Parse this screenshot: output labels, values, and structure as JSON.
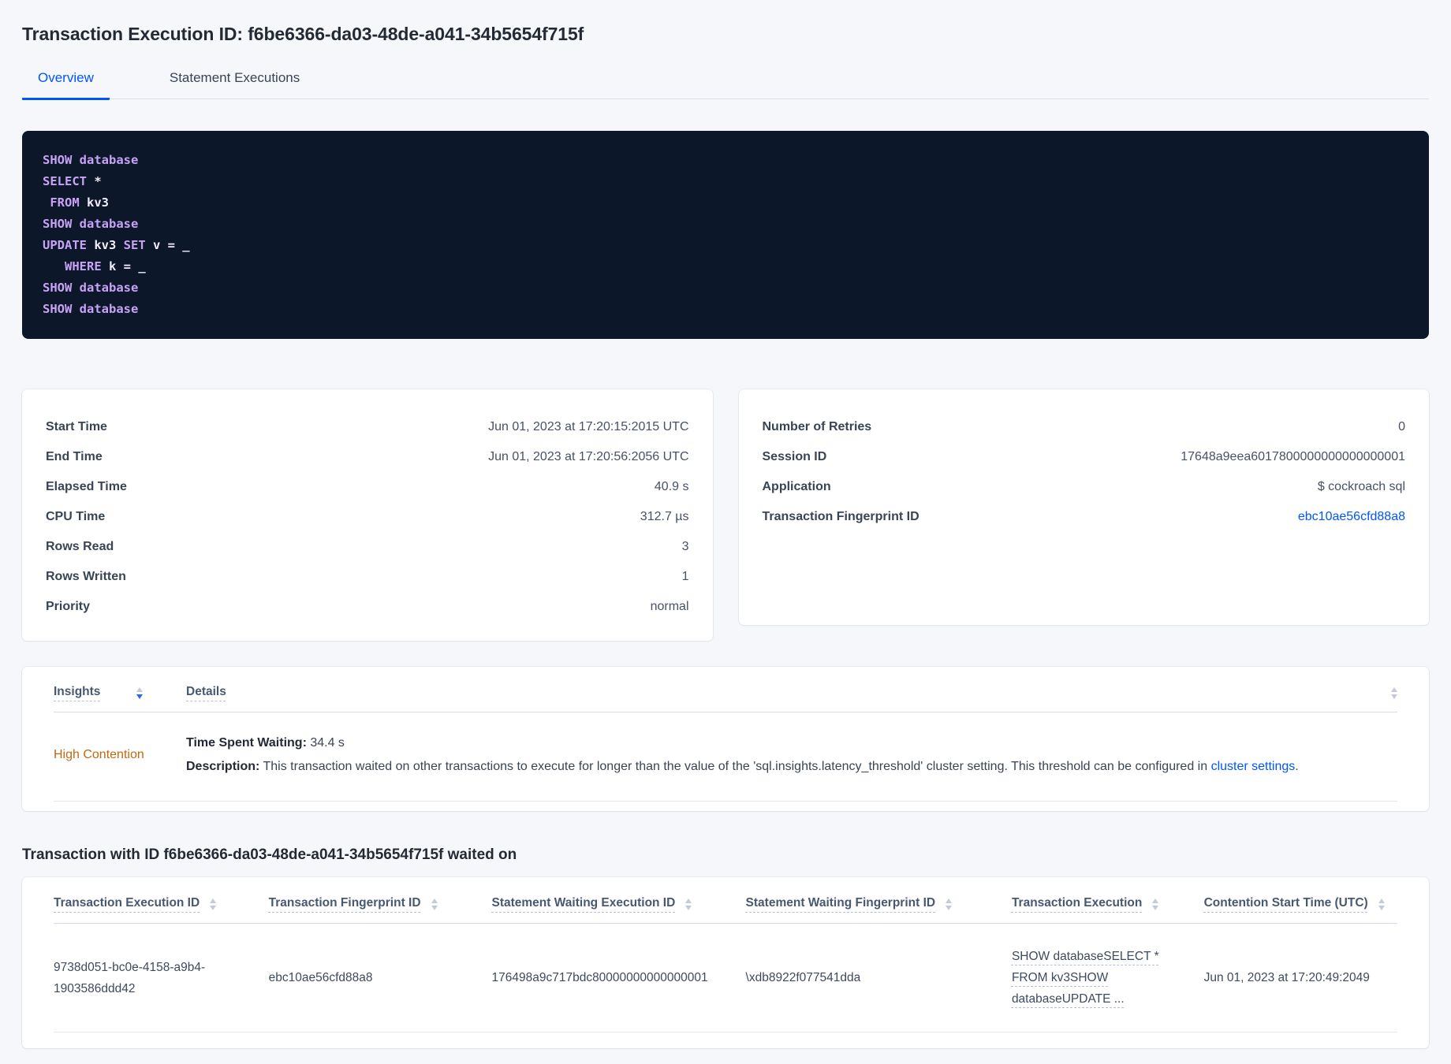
{
  "page": {
    "title": "Transaction Execution ID: f6be6366-da03-48de-a041-34b5654f715f"
  },
  "tabs": [
    {
      "label": "Overview",
      "active": true
    },
    {
      "label": "Statement Executions",
      "active": false
    }
  ],
  "sql": {
    "lines": [
      {
        "tokens": [
          {
            "t": "SHOW database",
            "c": "kw"
          }
        ]
      },
      {
        "tokens": [
          {
            "t": "SELECT ",
            "c": "kw"
          },
          {
            "t": "*",
            "c": "id"
          }
        ]
      },
      {
        "tokens": [
          {
            "t": " FROM ",
            "c": "kw"
          },
          {
            "t": "kv3",
            "c": "id"
          }
        ]
      },
      {
        "tokens": [
          {
            "t": "SHOW database",
            "c": "kw"
          }
        ]
      },
      {
        "tokens": [
          {
            "t": "UPDATE ",
            "c": "kw"
          },
          {
            "t": "kv3 ",
            "c": "id"
          },
          {
            "t": "SET ",
            "c": "kw"
          },
          {
            "t": "v = _",
            "c": "id"
          }
        ]
      },
      {
        "tokens": [
          {
            "t": "   WHERE ",
            "c": "kw"
          },
          {
            "t": "k = _",
            "c": "id"
          }
        ]
      },
      {
        "tokens": [
          {
            "t": "SHOW database",
            "c": "kw"
          }
        ]
      },
      {
        "tokens": [
          {
            "t": "SHOW database",
            "c": "kw"
          }
        ]
      }
    ]
  },
  "stats_left": {
    "rows": [
      {
        "label": "Start Time",
        "value": "Jun 01, 2023 at 17:20:15:2015 UTC"
      },
      {
        "label": "End Time",
        "value": "Jun 01, 2023 at 17:20:56:2056 UTC"
      },
      {
        "label": "Elapsed Time",
        "value": "40.9 s"
      },
      {
        "label": "CPU Time",
        "value": "312.7 µs"
      },
      {
        "label": "Rows Read",
        "value": "3"
      },
      {
        "label": "Rows Written",
        "value": "1"
      },
      {
        "label": "Priority",
        "value": "normal"
      }
    ]
  },
  "stats_right": {
    "rows": [
      {
        "label": "Number of Retries",
        "value": "0"
      },
      {
        "label": "Session ID",
        "value": "17648a9eea6017800000000000000001"
      },
      {
        "label": "Application",
        "value": "$ cockroach sql"
      },
      {
        "label": "Transaction Fingerprint ID",
        "value": "ebc10ae56cfd88a8"
      }
    ]
  },
  "insights_table": {
    "columns": [
      {
        "label": "Insights"
      },
      {
        "label": "Details"
      }
    ],
    "row": {
      "insight": "High Contention",
      "waiting_label": "Time Spent Waiting:",
      "waiting_value": " 34.4 s",
      "description_label": "Description:",
      "description_text": " This transaction waited on other transactions to execute for longer than the value of the 'sql.insights.latency_threshold' cluster setting. This threshold can be configured in ",
      "description_link": "cluster settings",
      "description_suffix": "."
    }
  },
  "waited_section": {
    "heading": "Transaction with ID f6be6366-da03-48de-a041-34b5654f715f waited on",
    "columns": [
      {
        "label": "Transaction Execution ID"
      },
      {
        "label": "Transaction Fingerprint ID"
      },
      {
        "label": "Statement Waiting Execution ID"
      },
      {
        "label": "Statement Waiting Fingerprint ID"
      },
      {
        "label": "Transaction Execution"
      },
      {
        "label": "Contention Start Time (UTC)"
      }
    ],
    "row": {
      "txn_execution_id": "9738d051-bc0e-4158-a9b4-1903586ddd42",
      "txn_fingerprint_id": "ebc10ae56cfd88a8",
      "stmt_waiting_execution_id": "176498a9c717bdc80000000000000001",
      "stmt_waiting_fingerprint_id": "\\xdb8922f077541dda",
      "txn_execution": "SHOW databaseSELECT * FROM kv3SHOW databaseUPDATE ...",
      "contention_start": "Jun 01, 2023 at 17:20:49:2049"
    }
  },
  "colors": {
    "accent-blue": "#0055ff",
    "warning-orange": "#c2690f",
    "sql-bg": "#0c1729",
    "sql-keyword": "#c8a3f5",
    "sql-text": "#f1edfb",
    "page-bg": "#f5f7fa"
  }
}
